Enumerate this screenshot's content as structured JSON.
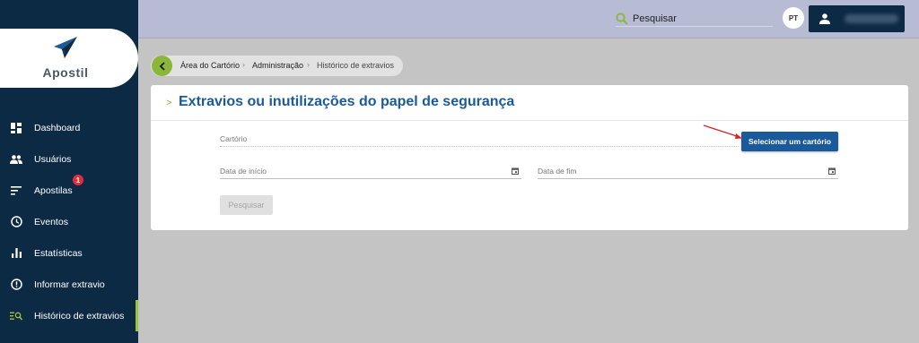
{
  "app": {
    "name": "Apostil"
  },
  "sidebar": {
    "items": [
      {
        "label": "Dashboard",
        "icon": "dashboard-icon"
      },
      {
        "label": "Usuários",
        "icon": "users-icon"
      },
      {
        "label": "Apostilas",
        "icon": "list-icon",
        "badge": "1"
      },
      {
        "label": "Eventos",
        "icon": "clock-icon"
      },
      {
        "label": "Estatísticas",
        "icon": "bar-chart-icon"
      },
      {
        "label": "Informar extravio",
        "icon": "alert-icon"
      },
      {
        "label": "Histórico de extravios",
        "icon": "history-search-icon",
        "active": true
      }
    ]
  },
  "topbar": {
    "search_placeholder": "Pesquisar",
    "avatar_initials": "PT"
  },
  "breadcrumb": {
    "items": [
      "Área do Cartório",
      "Administração",
      "Histórico de extravios"
    ]
  },
  "card": {
    "title": "Extravios ou inutilizações do papel de segurança",
    "cartorio_label": "Cartório",
    "select_button": "Selecionar um cartório",
    "data_inicio_label": "Data de início",
    "data_fim_label": "Data de fim",
    "search_button": "Pesquisar"
  },
  "colors": {
    "sidebar_bg": "#0d2a45",
    "accent_green": "#8ab73a",
    "primary_blue": "#1b5a9a",
    "badge_red": "#e02f3a"
  }
}
